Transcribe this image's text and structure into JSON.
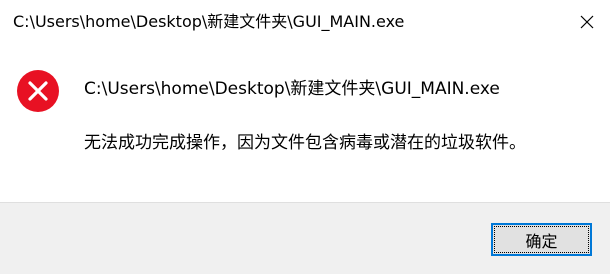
{
  "window": {
    "title": "C:\\Users\\home\\Desktop\\新建文件夹\\GUI_MAIN.exe",
    "close_icon": "close-icon"
  },
  "message": {
    "icon": "error-icon",
    "path": "C:\\Users\\home\\Desktop\\新建文件夹\\GUI_MAIN.exe",
    "text": "无法成功完成操作，因为文件包含病毒或潜在的垃圾软件。"
  },
  "footer": {
    "ok_label": "确定"
  },
  "colors": {
    "error_red": "#e81123",
    "accent_blue": "#0078d7",
    "footer_bg": "#f0f0f0"
  }
}
